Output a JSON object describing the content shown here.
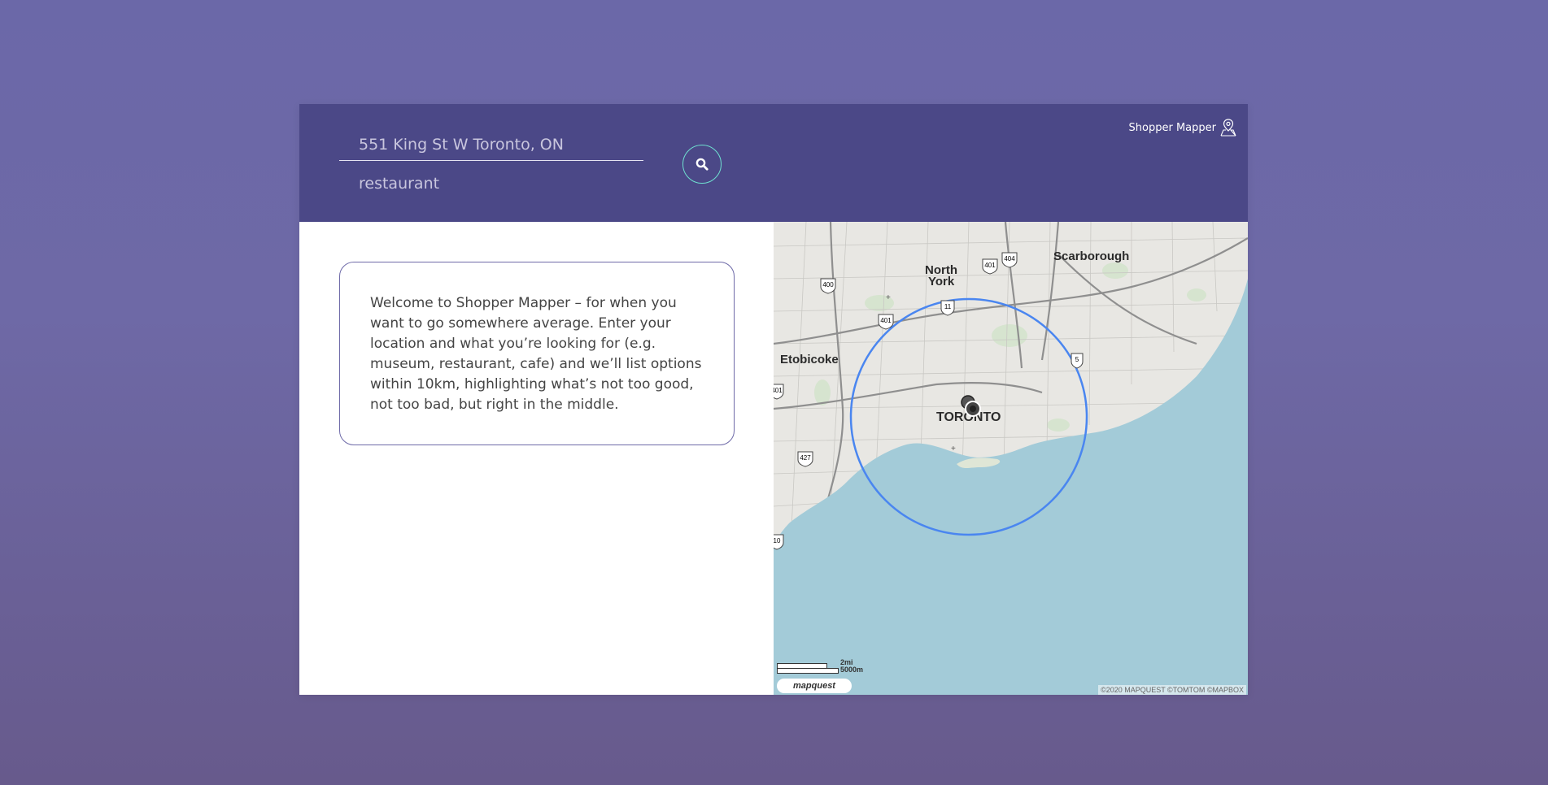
{
  "search": {
    "address_placeholder": "551 King St W Toronto, ON",
    "type_placeholder": "restaurant"
  },
  "brand": {
    "name": "Shopper Mapper",
    "icon": "map-pin-icon"
  },
  "welcome": {
    "text": "Welcome to Shopper Mapper – for when you want to go somewhere average. Enter your location and what you’re looking for (e.g. museum, restaurant, cafe) and we’ll list options within 10km, highlighting what’s not too good, not too bad, but right in the middle."
  },
  "map": {
    "labels": {
      "north_york": [
        "North",
        "York"
      ],
      "scarborough": "Scarborough",
      "etobicoke": "Etobicoke",
      "toronto": "TORONTO"
    },
    "highways": [
      "400",
      "401",
      "404",
      "11",
      "401",
      "5",
      "427",
      "401",
      "10"
    ],
    "scale": {
      "miles": "2mi",
      "meters": "5000m"
    },
    "logo": "mapquest",
    "attribution": "©2020 MAPQUEST ©TOMTOM ©MAPBOX",
    "radius_color": "#4a86f0",
    "water_color": "#a3cbd8"
  },
  "colors": {
    "header": "#4b4887",
    "accent": "#6fe0d0"
  }
}
